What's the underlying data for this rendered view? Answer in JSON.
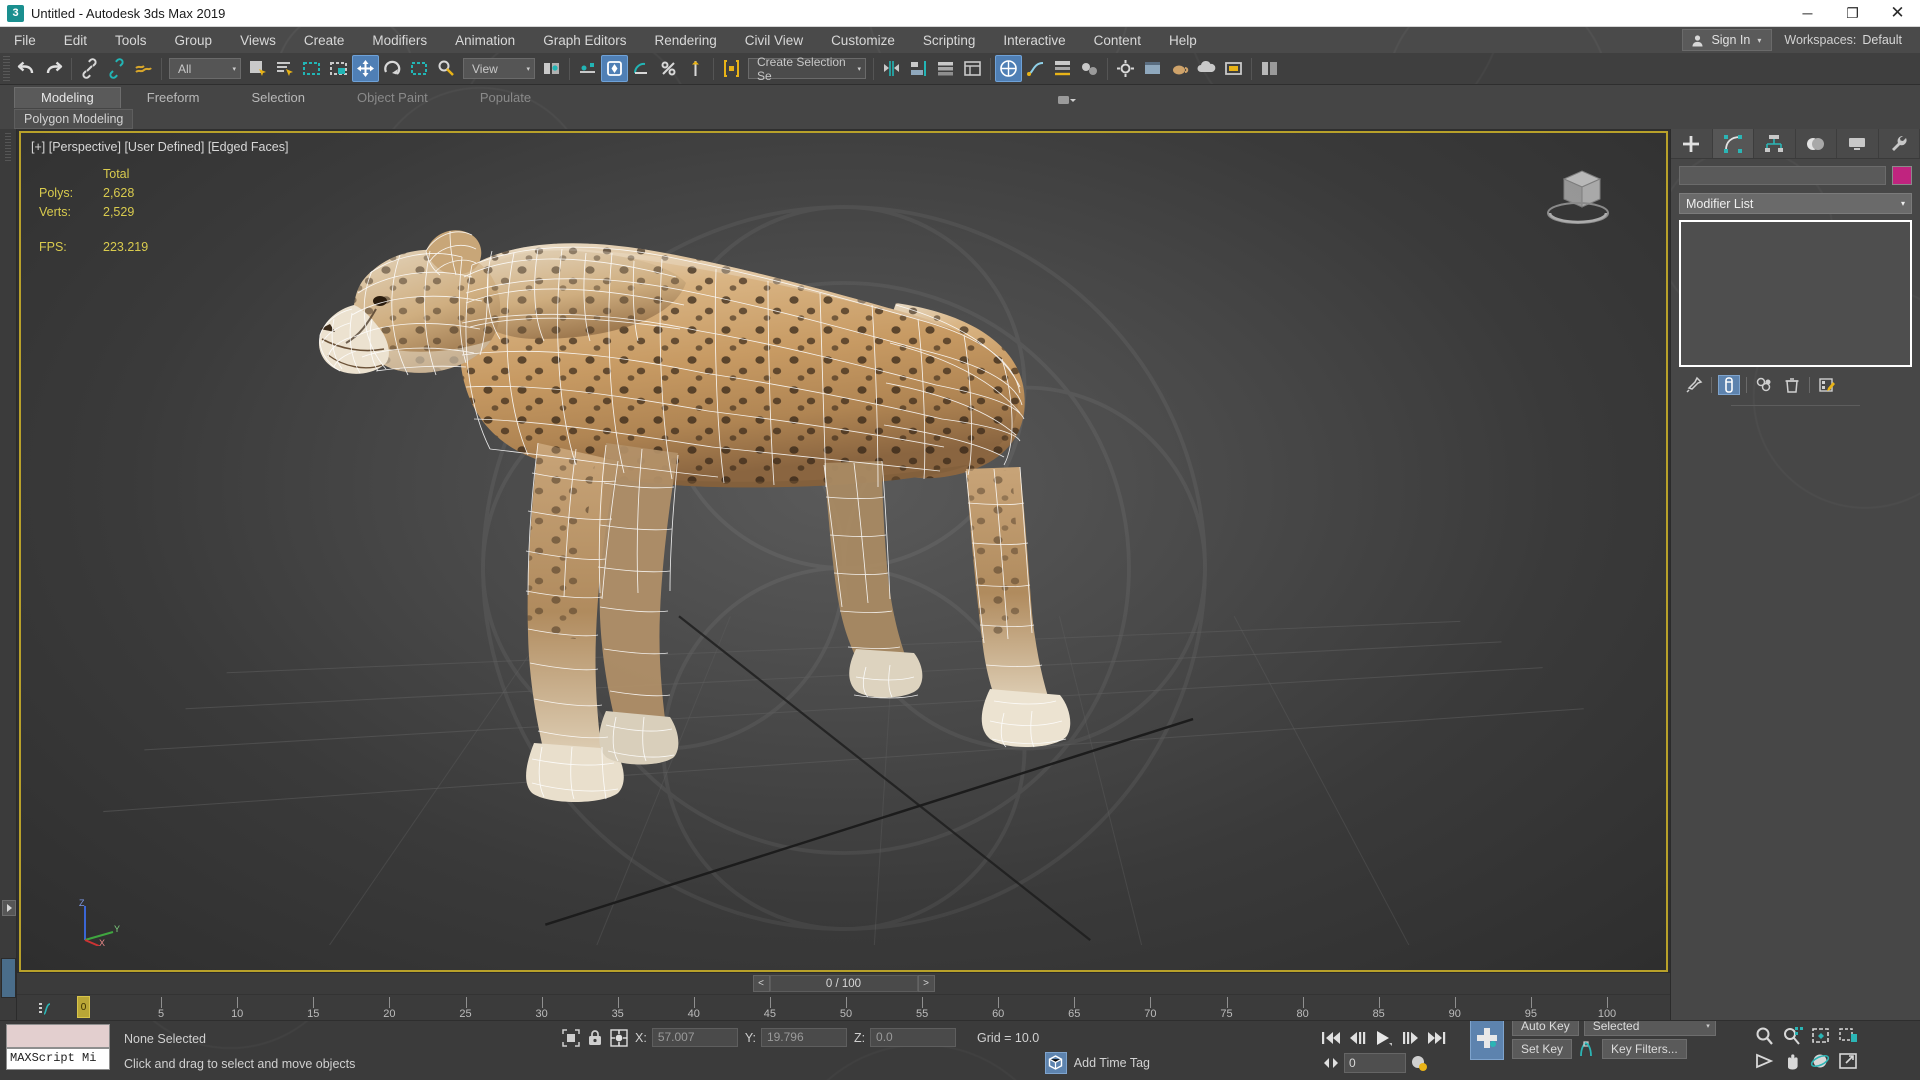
{
  "window": {
    "title": "Untitled - Autodesk 3ds Max 2019",
    "app_icon": "3",
    "minimize": "─",
    "maximize": "❐",
    "close": "✕"
  },
  "menubar": {
    "items": [
      "File",
      "Edit",
      "Tools",
      "Group",
      "Views",
      "Create",
      "Modifiers",
      "Animation",
      "Graph Editors",
      "Rendering",
      "Civil View",
      "Customize",
      "Scripting",
      "Interactive",
      "Content",
      "Help"
    ],
    "signin_label": "Sign In",
    "signin_caret": "▾",
    "workspaces_label": "Workspaces:",
    "workspaces_value": "Default"
  },
  "toolbar": {
    "selection_filter": "All",
    "reference_coord": "View",
    "selection_set_placeholder": "Create Selection Se",
    "dropdown_arrow": "▾"
  },
  "ribbon": {
    "tabs": [
      {
        "label": "Modeling",
        "active": true
      },
      {
        "label": "Freeform",
        "active": false
      },
      {
        "label": "Selection",
        "active": false
      },
      {
        "label": "Object Paint",
        "active": false
      },
      {
        "label": "Populate",
        "active": false
      }
    ],
    "subtab": "Polygon Modeling"
  },
  "viewport": {
    "label": "[+] [Perspective] [User Defined] [Edged Faces]",
    "stats": {
      "header": "Total",
      "rows": [
        {
          "key": "Polys:",
          "value": "2,628"
        },
        {
          "key": "Verts:",
          "value": "2,529"
        }
      ],
      "fps_key": "FPS:",
      "fps_value": "223.219"
    },
    "axis": {
      "x": "X",
      "y": "Y",
      "z": "Z"
    },
    "viewcube": "view-cube"
  },
  "timeslider": {
    "prev": "<",
    "next": ">",
    "frame_display": "0 / 100",
    "current_frame_marker": "0"
  },
  "ruler": {
    "ticks": [
      0,
      5,
      10,
      15,
      20,
      25,
      30,
      35,
      40,
      45,
      50,
      55,
      60,
      65,
      70,
      75,
      80,
      85,
      90,
      95,
      100
    ]
  },
  "command_panel": {
    "tabs": [
      {
        "name": "create",
        "icon": "plus-icon",
        "active": false
      },
      {
        "name": "modify",
        "icon": "modify-icon",
        "active": true
      },
      {
        "name": "hierarchy",
        "icon": "hierarchy-icon",
        "active": false
      },
      {
        "name": "motion",
        "icon": "motion-icon",
        "active": false
      },
      {
        "name": "display",
        "icon": "display-icon",
        "active": false
      },
      {
        "name": "utilities",
        "icon": "wrench-icon",
        "active": false
      }
    ],
    "object_name": "",
    "color_swatch": "#c0247f",
    "modifier_list_label": "Modifier List",
    "modifier_list_arrow": "▾",
    "stack_tools": [
      "pin-stack-icon",
      "show-end-result-icon",
      "make-unique-icon",
      "remove-modifier-icon",
      "configure-sets-icon"
    ]
  },
  "statusbar": {
    "maxscript_label": "MAXScript Mi",
    "selection_status": "None Selected",
    "prompt": "Click and drag to select and move objects",
    "coords": {
      "x_label": "X:",
      "x_value": "57.007",
      "y_label": "Y:",
      "y_value": "19.796",
      "z_label": "Z:",
      "z_value": "0.0",
      "grid": "Grid = 10.0"
    },
    "add_time_tag": "Add Time Tag"
  },
  "animation": {
    "auto_key": "Auto Key",
    "set_key": "Set Key",
    "key_mode": "Selected",
    "key_mode_arrow": "▾",
    "key_filters": "Key Filters...",
    "current_frame": "0",
    "spinner": "↕"
  }
}
